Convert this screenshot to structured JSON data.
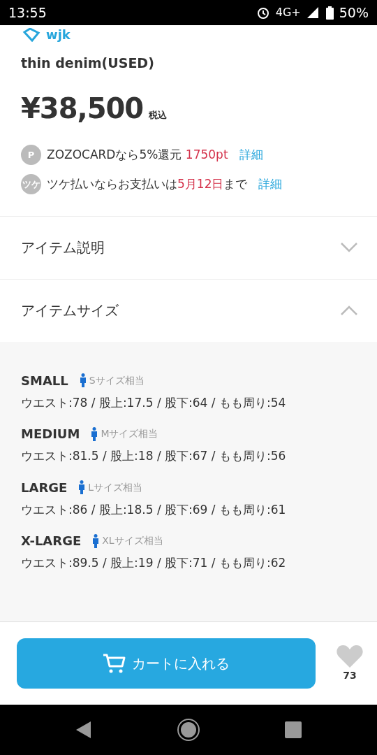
{
  "status_bar": {
    "time": "13:55",
    "network": "4G+",
    "battery": "50%"
  },
  "brand": "wjk",
  "title": "thin denim(USED)",
  "price": {
    "amount": "¥38,500",
    "tax_note": "税込"
  },
  "offers": [
    {
      "icon": "P",
      "parts": [
        {
          "text": "ZOZOCARDなら5%還元 ",
          "highlight": false
        },
        {
          "text": "1750pt",
          "highlight": true
        }
      ],
      "link": "詳細"
    },
    {
      "icon": "ツケ",
      "parts": [
        {
          "text": "ツケ払いならお支払いは",
          "highlight": false
        },
        {
          "text": "5月12日",
          "highlight": true
        },
        {
          "text": "まで",
          "highlight": false
        }
      ],
      "link": "詳細"
    }
  ],
  "sections": [
    {
      "label": "アイテム説明",
      "expanded": false
    },
    {
      "label": "アイテムサイズ",
      "expanded": true
    }
  ],
  "sizes": [
    {
      "name": "SMALL",
      "equivalent": "Sサイズ相当",
      "measurements": "ウエスト:78 / 股上:17.5 / 股下:64 / もも周り:54"
    },
    {
      "name": "MEDIUM",
      "equivalent": "Mサイズ相当",
      "measurements": "ウエスト:81.5 / 股上:18 / 股下:67 / もも周り:56"
    },
    {
      "name": "LARGE",
      "equivalent": "Lサイズ相当",
      "measurements": "ウエスト:86 / 股上:18.5 / 股下:69 / もも周り:61"
    },
    {
      "name": "X-LARGE",
      "equivalent": "XLサイズ相当",
      "measurements": "ウエスト:89.5 / 股上:19 / 股下:71 / もも周り:62"
    }
  ],
  "cart_button": "カートに入れる",
  "favorites": "73"
}
